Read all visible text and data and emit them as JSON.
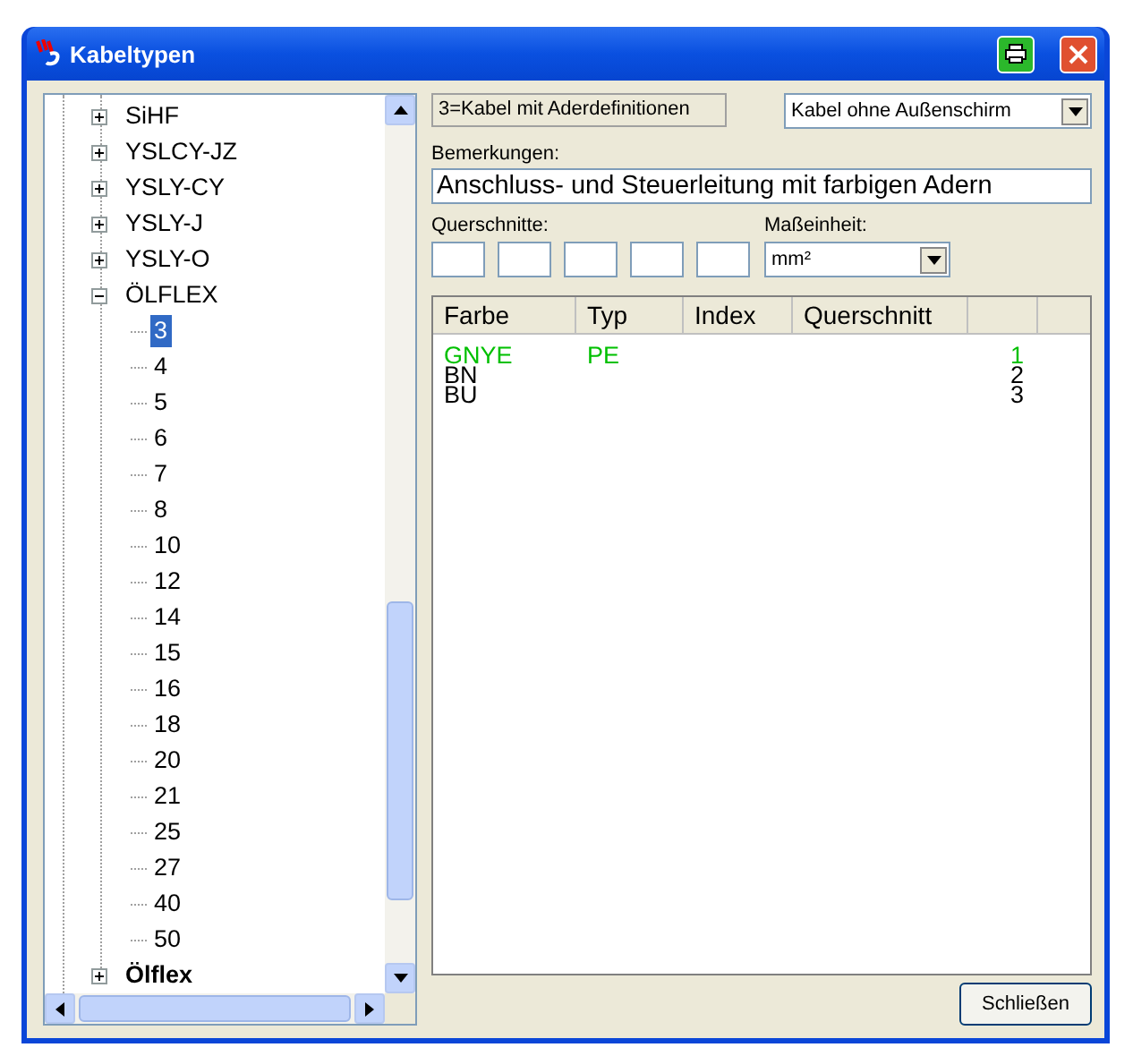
{
  "window": {
    "title": "Kabeltypen"
  },
  "tree": {
    "items": [
      {
        "label": "SiHF",
        "expanded": false,
        "bold": false
      },
      {
        "label": "YSLCY-JZ",
        "expanded": false,
        "bold": false
      },
      {
        "label": "YSLY-CY",
        "expanded": false,
        "bold": false
      },
      {
        "label": "YSLY-J",
        "expanded": false,
        "bold": false
      },
      {
        "label": "YSLY-O",
        "expanded": false,
        "bold": false
      },
      {
        "label": "ÖLFLEX",
        "expanded": true,
        "bold": false,
        "children": [
          {
            "label": "3",
            "selected": true
          },
          {
            "label": "4",
            "selected": false
          },
          {
            "label": "5",
            "selected": false
          },
          {
            "label": "6",
            "selected": false
          },
          {
            "label": "7",
            "selected": false
          },
          {
            "label": "8",
            "selected": false
          },
          {
            "label": "10",
            "selected": false
          },
          {
            "label": "12",
            "selected": false
          },
          {
            "label": "14",
            "selected": false
          },
          {
            "label": "15",
            "selected": false
          },
          {
            "label": "16",
            "selected": false
          },
          {
            "label": "18",
            "selected": false
          },
          {
            "label": "20",
            "selected": false
          },
          {
            "label": "21",
            "selected": false
          },
          {
            "label": "25",
            "selected": false
          },
          {
            "label": "27",
            "selected": false
          },
          {
            "label": "40",
            "selected": false
          },
          {
            "label": "50",
            "selected": false
          }
        ]
      },
      {
        "label": "Ölflex",
        "expanded": false,
        "bold": true
      }
    ]
  },
  "type_label": "3=Kabel mit Aderdefinitionen",
  "shield_select": {
    "value": "Kabel ohne Außenschirm"
  },
  "remarks": {
    "label": "Bemerkungen:",
    "value": "Anschluss- und Steuerleitung mit farbigen Adern"
  },
  "cross_sections": {
    "label": "Querschnitte:",
    "fields": [
      {
        "kind": "input"
      },
      {
        "kind": "input"
      },
      {
        "kind": "input"
      },
      {
        "kind": "input"
      },
      {
        "kind": "input"
      }
    ]
  },
  "unit": {
    "label": "Maßeinheit:",
    "value": "mm²"
  },
  "table": {
    "columns": [
      "Farbe",
      "Typ",
      "Index",
      "Querschnitt"
    ],
    "rows": [
      {
        "farbe": "GNYE",
        "typ": "PE",
        "column_5": "1",
        "color": "#00c000"
      },
      {
        "farbe": "BN",
        "column_5": "2",
        "color": "#000000"
      },
      {
        "farbe": "BU",
        "column_5": "3",
        "color": "#000000"
      }
    ]
  },
  "buttons": [
    "Schließen"
  ]
}
